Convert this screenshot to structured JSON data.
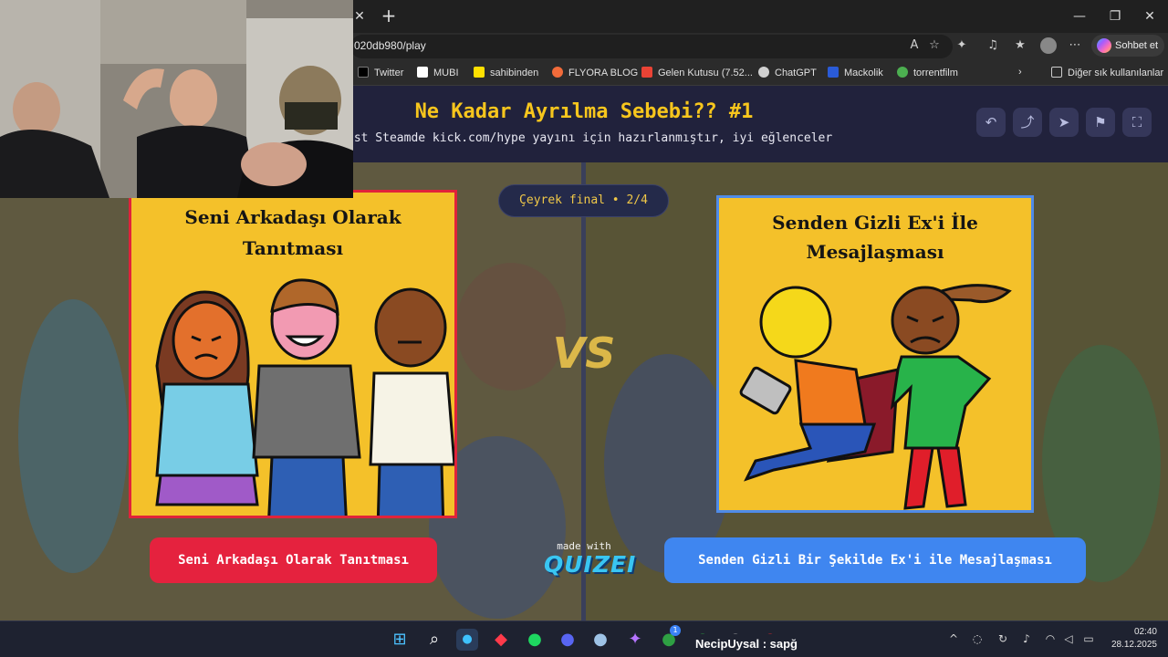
{
  "browser": {
    "url": "020db980/play",
    "new_tab_glyph": "+",
    "close_tab_glyph": "✕",
    "copilot_label": "Sohbet et",
    "bookmarks": [
      {
        "label": "Twitter",
        "icon": "x-icon",
        "color": "#000000"
      },
      {
        "label": "MUBI",
        "icon": "mubi-icon",
        "color": "#ffffff"
      },
      {
        "label": "sahibinden",
        "icon": "sahibinden-icon",
        "color": "#ffe000"
      },
      {
        "label": "FLYORA BLOG",
        "icon": "flyora-icon",
        "color": "#f26b3a"
      },
      {
        "label": "Gelen Kutusu (7.52...",
        "icon": "gmail-icon",
        "color": "#ea4335"
      },
      {
        "label": "ChatGPT",
        "icon": "chatgpt-icon",
        "color": "#d0d0d0"
      },
      {
        "label": "Mackolik",
        "icon": "mackolik-icon",
        "color": "#2a5bd7"
      },
      {
        "label": "torrentfilm",
        "icon": "torrentfilm-icon",
        "color": "#4caf50"
      }
    ],
    "other_favorites": "Diğer sık kullanılanlar"
  },
  "quiz": {
    "title": "Ne Kadar Ayrılma Sebebi?? #1",
    "subtitle": "ust Steamde kick.com/hype yayını için hazırlanmıştır, iyi eğlenceler",
    "round": "Çeyrek final • 2/4",
    "vs": "VS",
    "made_with": "made with",
    "brand": "QUIZEI",
    "left": {
      "card_title_line1": "Seni Arkadaşı Olarak",
      "card_title_line2": "Tanıtması",
      "button": "Seni Arkadaşı Olarak Tanıtması",
      "accent": "#e5223e"
    },
    "right": {
      "card_title_line1": "Senden Gizli Ex'i İle",
      "card_title_line2": "Mesajlaşması",
      "button": "Senden Gizli Bir Şekilde Ex'i ile Mesajlaşması",
      "accent": "#3f86f0"
    }
  },
  "taskbar": {
    "overlay_text": "NecipUysal : sapğ",
    "time": "02:40",
    "date": "28.12.2025",
    "badge": "1"
  }
}
